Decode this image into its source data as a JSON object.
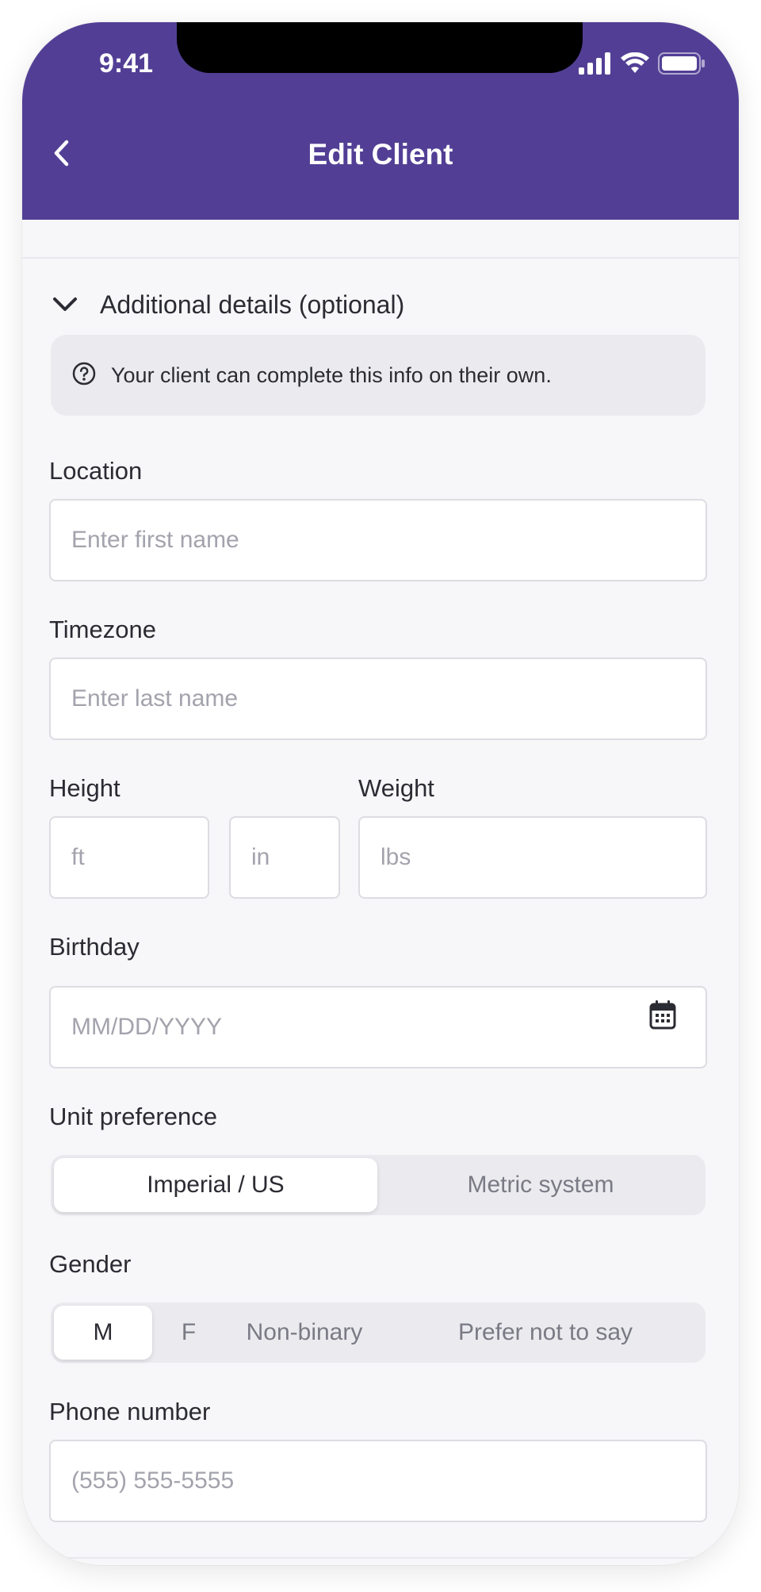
{
  "status_bar": {
    "time": "9:41",
    "icons": [
      "signal-icon",
      "wifi-icon",
      "battery-icon"
    ]
  },
  "header": {
    "title": "Edit Client",
    "back_icon": "chevron-left-icon",
    "background_color": "#523f95"
  },
  "section": {
    "title": "Additional details (optional)",
    "toggle_icon": "chevron-down-icon",
    "info_icon": "help-circle-icon",
    "info_text": "Your client can complete this info on their own."
  },
  "fields": {
    "location": {
      "label": "Location",
      "placeholder": "Enter first name",
      "value": ""
    },
    "timezone": {
      "label": "Timezone",
      "placeholder": "Enter last name",
      "value": ""
    },
    "height": {
      "label": "Height",
      "ft_placeholder": "ft",
      "in_placeholder": "in"
    },
    "weight": {
      "label": "Weight",
      "placeholder": "lbs"
    },
    "birthday": {
      "label": "Birthday",
      "placeholder": "MM/DD/YYYY",
      "icon": "calendar-icon"
    },
    "phone": {
      "label": "Phone number",
      "placeholder": "(555) 555-5555"
    }
  },
  "unit_preference": {
    "label": "Unit preference",
    "options": [
      "Imperial / US",
      "Metric system"
    ],
    "selected": "Imperial / US"
  },
  "gender": {
    "label": "Gender",
    "options": [
      "M",
      "F",
      "Non-binary",
      "Prefer not to say"
    ],
    "selected": "M"
  }
}
